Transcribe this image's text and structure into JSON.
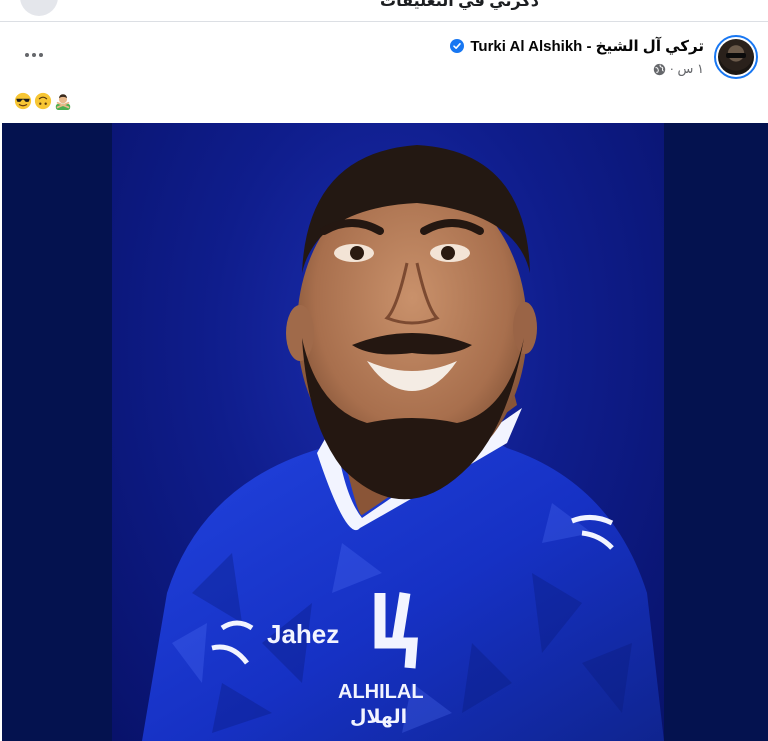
{
  "previous_post": {
    "cut_text": "ذكرني في التعليقات"
  },
  "post": {
    "author": "Turki Al Alshikh - تركي آل الشيخ",
    "verified": true,
    "time": "١ س ·",
    "privacy_icon": "globe-icon",
    "more_icon": "more-horizontal-icon",
    "caption_emojis": [
      "person-gesturing-no-emoji",
      "upside-down-face-emoji",
      "smiling-face-with-sunglasses-emoji"
    ],
    "avatar_icon": "profile-avatar"
  },
  "media": {
    "jersey_text": "Jahez",
    "club_name": "ALHILAL",
    "club_name_ar": "الهلال",
    "colors": {
      "background": "#04124f",
      "jersey": "#1f3bd6",
      "collar": "#ffffff"
    }
  }
}
